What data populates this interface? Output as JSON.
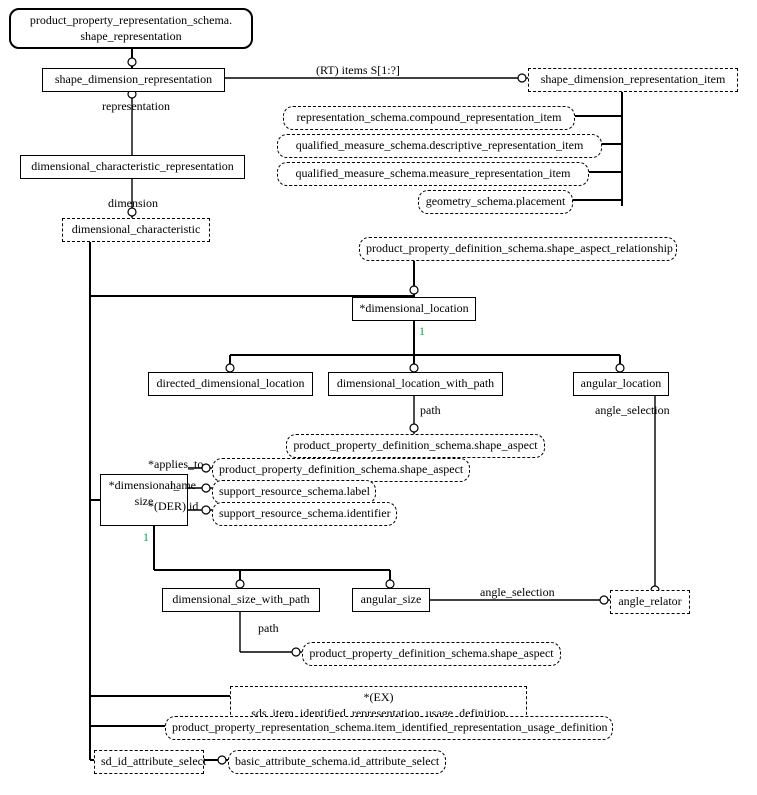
{
  "nodes": {
    "n1": "product_property_representation_schema.\nshape_representation",
    "n2": "shape_dimension_representation",
    "n3": "shape_dimension_representation_item",
    "n4": "representation_schema.compound_representation_item",
    "n5": "qualified_measure_schema.descriptive_representation_item",
    "n6": "qualified_measure_schema.measure_representation_item",
    "n7": "geometry_schema.placement",
    "n8": "dimensional_characteristic_representation",
    "n9": "dimensional_characteristic",
    "n10": "product_property_definition_schema.shape_aspect_relationship",
    "n11": "*dimensional_location",
    "n12": "directed_dimensional_location",
    "n13": "dimensional_location_with_path",
    "n14": "angular_location",
    "n15": "product_property_definition_schema.shape_aspect",
    "n16": "*dimensional_\nsize",
    "n17": "product_property_definition_schema.shape_aspect",
    "n18": "support_resource_schema.label",
    "n19": "support_resource_schema.identifier",
    "n20": "dimensional_size_with_path",
    "n21": "angular_size",
    "n22": "angle_relator",
    "n23": "product_property_definition_schema.shape_aspect",
    "n24": "*(EX) sds_item_identified_representation_usage_definition",
    "n25": "product_property_representation_schema.item_identified_representation_usage_definition",
    "n26": "sd_id_attribute_select",
    "n27": "basic_attribute_schema.id_attribute_select"
  },
  "labels": {
    "l_items": "(RT) items S[1:?]",
    "l_repr": "representation",
    "l_dim": "dimension",
    "l_one_a": "1",
    "l_path1": "path",
    "l_angsel1": "angle_selection",
    "l_applies": "*applies_to",
    "l_name": "name",
    "l_derid": "*(DER) id",
    "l_one_b": "1",
    "l_angsel2": "angle_selection",
    "l_path2": "path"
  }
}
